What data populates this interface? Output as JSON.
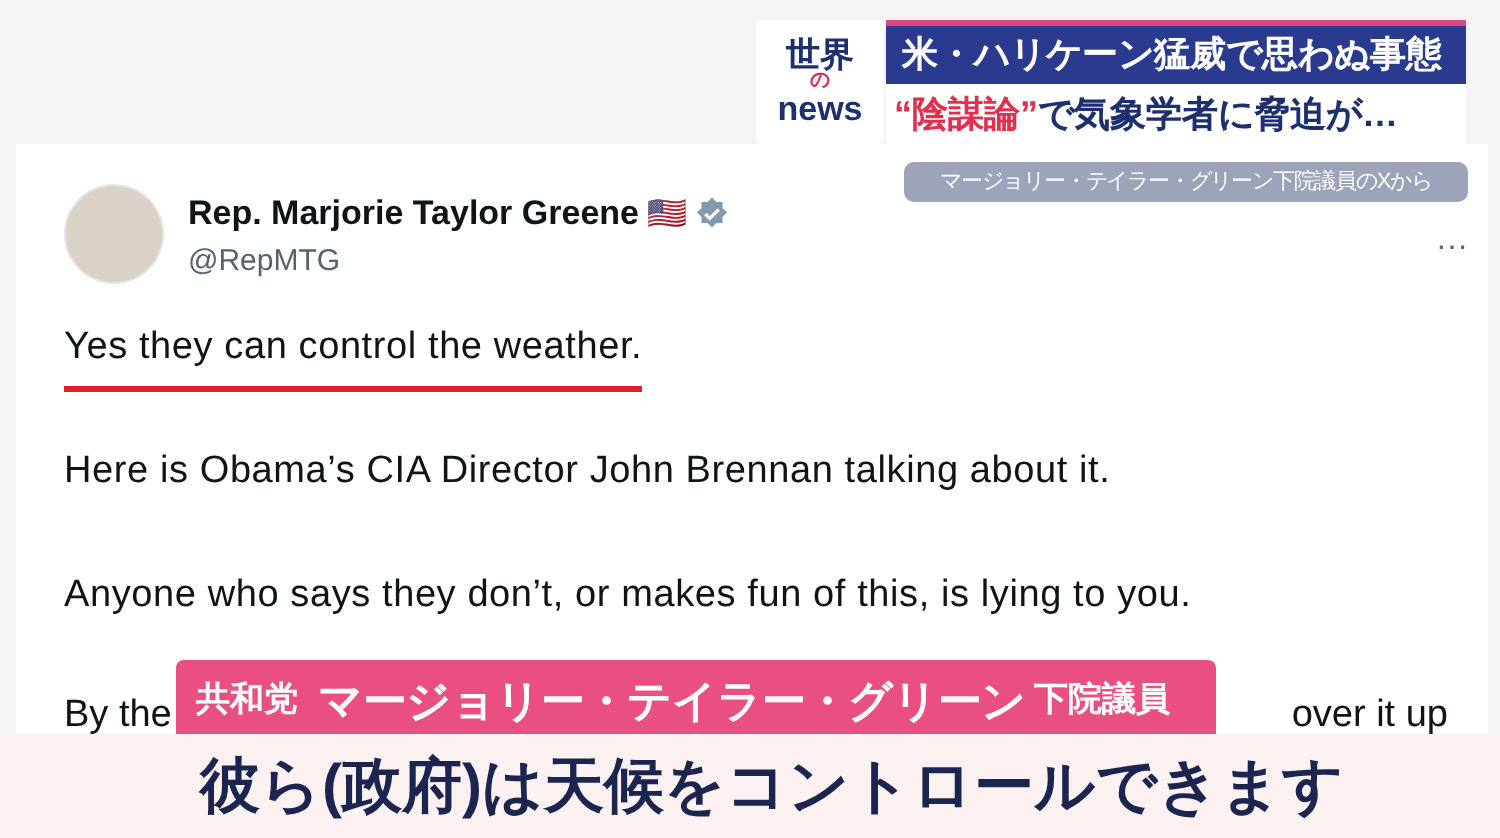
{
  "news_graphic": {
    "logo": {
      "top": "世界",
      "middle": "の",
      "bottom": "news"
    },
    "headline": "米・ハリケーン猛威で思わぬ事態",
    "subheadline": [
      {
        "kind": "emphasis",
        "text": "“陰謀論”"
      },
      {
        "kind": "plain",
        "text": "で気象学者に脅迫が…"
      }
    ],
    "source": "マージョリー・テイラー・グリーン下院議員のXから"
  },
  "tweet": {
    "name": "Rep. Marjorie Taylor Greene",
    "flag": "🇺🇸",
    "verified": true,
    "handle": "@RepMTG",
    "more": "···",
    "lines": [
      {
        "text": "Yes they can control the weather.",
        "underlined": true
      },
      {
        "text": "Here is Obama’s CIA Director John Brennan talking about it.",
        "underlined": false
      },
      {
        "text": "Anyone who says they don’t, or makes fun of this, is lying to you.",
        "underlined": false
      }
    ],
    "partial_line": {
      "left": "By the",
      "right": "over it up"
    }
  },
  "lower_third": {
    "party": "共和党",
    "name": "マージョリー・テイラー・グリーン",
    "title": "下院議員"
  },
  "subtitle": "彼ら(政府)は天候をコントロールできます"
}
